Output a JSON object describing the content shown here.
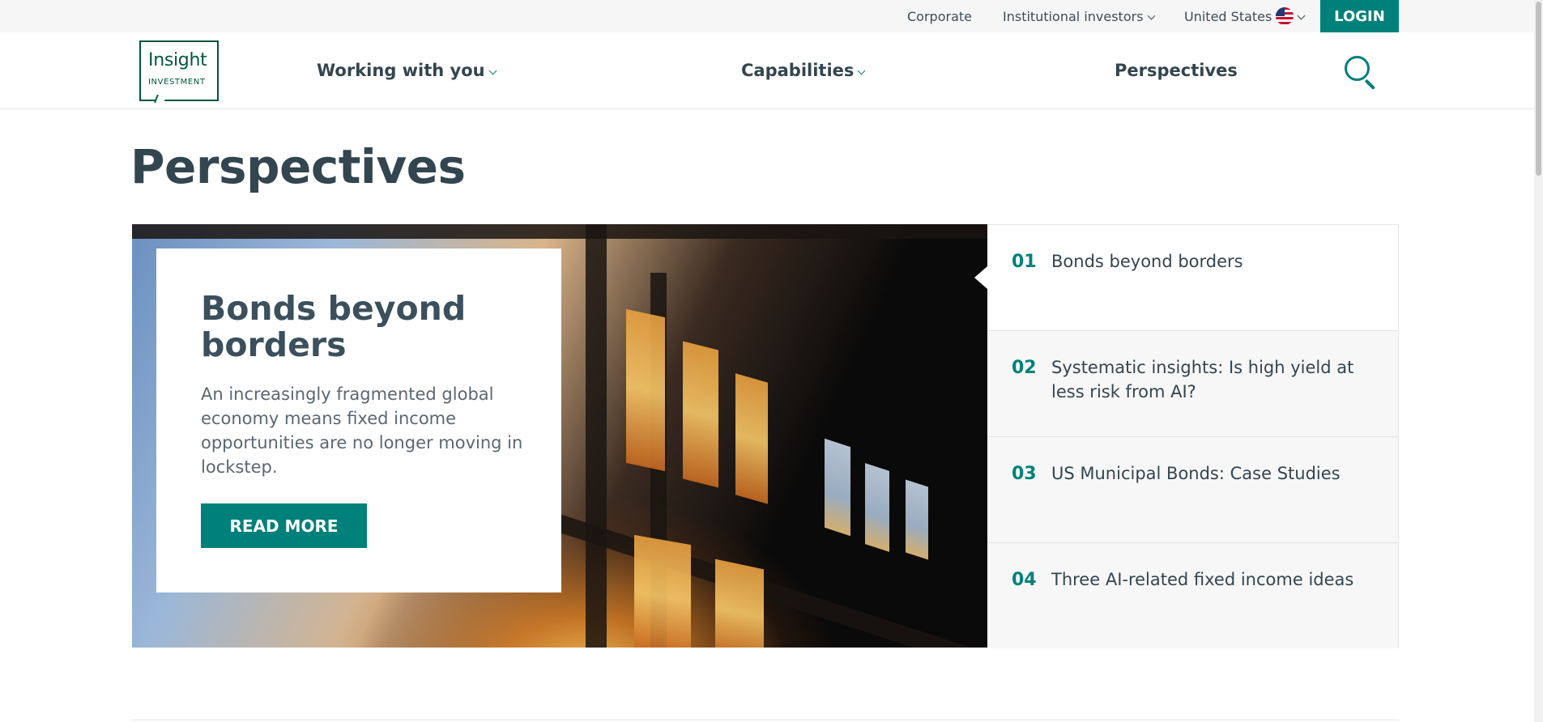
{
  "utility": {
    "corporate": "Corporate",
    "institutional": "Institutional investors",
    "country": "United States",
    "login": "LOGIN"
  },
  "logo": {
    "main": "Insight",
    "sub": "INVESTMENT"
  },
  "nav": {
    "working": "Working with you",
    "capabilities": "Capabilities",
    "perspectives": "Perspectives"
  },
  "page": {
    "title": "Perspectives"
  },
  "feature": {
    "title": "Bonds beyond borders",
    "description": "An increasingly fragmented global economy means fixed income opportunities are no longer moving in lockstep.",
    "cta": "READ MORE"
  },
  "articles": [
    {
      "num": "01",
      "title": "Bonds beyond borders"
    },
    {
      "num": "02",
      "title": "Systematic insights: Is high yield at less risk from AI?"
    },
    {
      "num": "03",
      "title": "US Municipal Bonds: Case Studies"
    },
    {
      "num": "04",
      "title": "Three AI-related fixed income ideas"
    }
  ],
  "icons": {
    "search": "search-icon",
    "flag": "us-flag-icon",
    "chevron": "chevron-down-icon"
  },
  "colors": {
    "accent": "#00807a",
    "text": "#33454f",
    "logo": "#00563f"
  }
}
